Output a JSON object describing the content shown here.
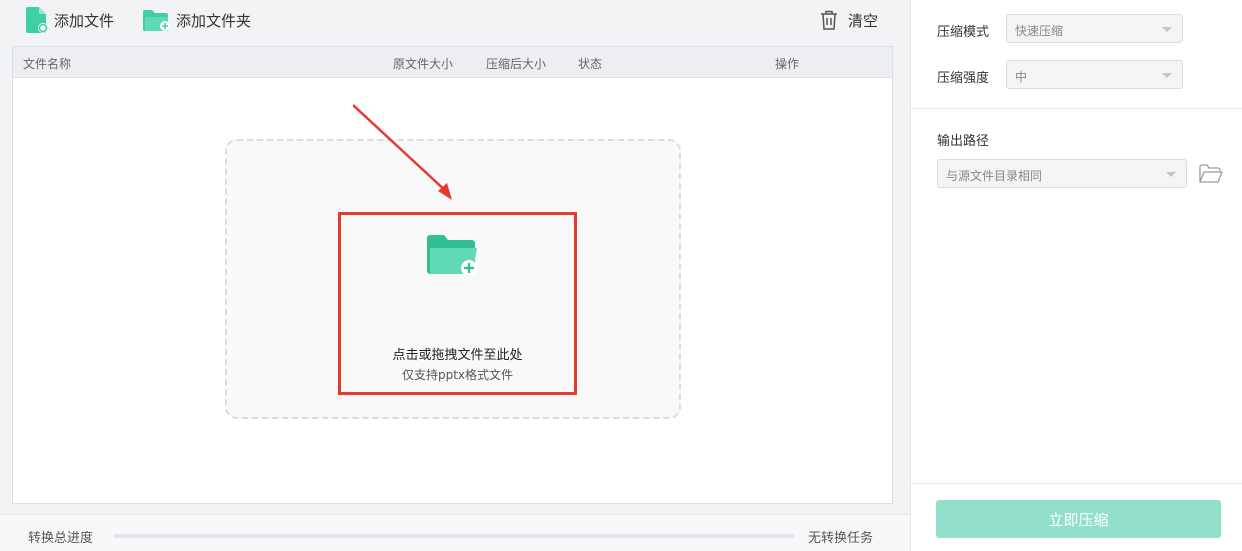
{
  "toolbar": {
    "add_file": "添加文件",
    "add_folder": "添加文件夹",
    "clear": "清空"
  },
  "table": {
    "columns": [
      "文件名称",
      "原文件大小",
      "压缩后大小",
      "状态",
      "操作"
    ]
  },
  "drop_zone": {
    "title": "点击或拖拽文件至此处",
    "subtitle": "仅支持pptx格式文件"
  },
  "footer": {
    "progress_label": "转换总进度",
    "progress": 0,
    "task_status": "无转换任务"
  },
  "settings": {
    "mode_label": "压缩模式",
    "mode_value": "快速压缩",
    "strength_label": "压缩强度",
    "strength_value": "中",
    "output_label": "输出路径",
    "output_value": "与源文件目录相同",
    "compress_button": "立即压缩"
  },
  "colors": {
    "accent": "#3ecfa5",
    "accent_light": "#92e0cb",
    "highlight_red": "#e53a2e"
  },
  "icons": [
    "file-add-icon",
    "folder-add-icon",
    "trash-icon",
    "folder-open-icon",
    "chevron-down-icon"
  ]
}
